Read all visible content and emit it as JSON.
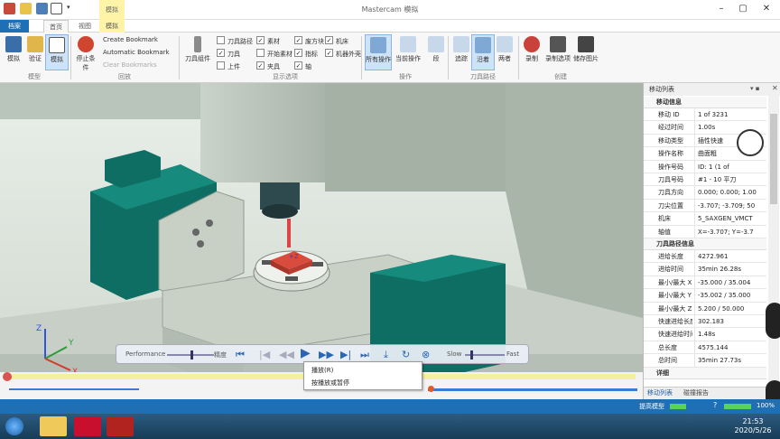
{
  "window": {
    "title": "Mastercam 模拟",
    "context_tab": "模拟"
  },
  "tabs": [
    "档案",
    "首页",
    "视图",
    "模拟"
  ],
  "ribbon": {
    "groups": {
      "model": "模型",
      "playback": "回放",
      "display": "显示选项",
      "ops": "操作",
      "toolpath": "刀具路径",
      "creation": "创建"
    },
    "buttons": {
      "sim": "模拟",
      "verify": "验证",
      "sim2": "模拟",
      "stop": "停止条件",
      "create_bookmark": "Create Bookmark",
      "auto_bookmark": "Automatic Bookmark",
      "clear_bookmarks": "Clear Bookmarks",
      "tool_group": "刀具组件",
      "all_ops": "所有操作",
      "current_op": "当前操作",
      "segment": "段",
      "trace": "追踪",
      "trail": "沿着",
      "both": "两者",
      "record": "录制",
      "record_export": "录制选项",
      "save_image": "储存图片"
    },
    "checkboxes": [
      {
        "label": "刀具路径",
        "checked": false
      },
      {
        "label": "刀具",
        "checked": true
      },
      {
        "label": "上件",
        "checked": false
      },
      {
        "label": "素材",
        "checked": true
      },
      {
        "label": "开始素材",
        "checked": false
      },
      {
        "label": "夹具",
        "checked": true
      },
      {
        "label": "废方块",
        "checked": true
      },
      {
        "label": "指标",
        "checked": true
      },
      {
        "label": "轴",
        "checked": true
      },
      {
        "label": "机床",
        "checked": true
      },
      {
        "label": "机器外壳",
        "checked": true
      }
    ]
  },
  "panel": {
    "title": "移动列表",
    "sections": {
      "move": "移动信息",
      "toolpath": "刀具路径信息",
      "detail": "详细"
    },
    "move_info": [
      {
        "k": "移动 ID",
        "v": "1 of 3231"
      },
      {
        "k": "经过时间",
        "v": "1.00s"
      },
      {
        "k": "移动类型",
        "v": "插性快速"
      },
      {
        "k": "操作名称",
        "v": "曲面粗"
      },
      {
        "k": "操作号码",
        "v": "ID: 1 (1 of"
      },
      {
        "k": "刀具号码",
        "v": "#1 - 10 平刀"
      },
      {
        "k": "刀具方向",
        "v": "0.000; 0.000; 1.00"
      },
      {
        "k": "刀尖位置",
        "v": "-3.707; -3.709; 50"
      },
      {
        "k": "机床",
        "v": "5_SAXGEN_VMCT"
      },
      {
        "k": "轴值",
        "v": "X=-3.707; Y=-3.7"
      }
    ],
    "toolpath_info": [
      {
        "k": "进给长度",
        "v": "4272.961"
      },
      {
        "k": "进给时间",
        "v": "35min 26.28s"
      },
      {
        "k": "最小/最大 X",
        "v": "-35.000 / 35.004"
      },
      {
        "k": "最小/最大 Y",
        "v": "-35.002 / 35.000"
      },
      {
        "k": "最小/最大 Z",
        "v": "5.200 / 50.000"
      },
      {
        "k": "快速进给长度",
        "v": "302.183"
      },
      {
        "k": "快速进给时间",
        "v": "1.48s"
      },
      {
        "k": "总长度",
        "v": "4575.144"
      },
      {
        "k": "总时间",
        "v": "35min 27.73s"
      }
    ],
    "tabs": {
      "move_list": "移动列表",
      "trace_report": "碰撞报告"
    }
  },
  "playbar": {
    "performance": "Performance",
    "precision": "精度",
    "slow": "Slow",
    "fast": "Fast"
  },
  "tooltip": {
    "title": "播放(R)",
    "desc": "按播放或暂停"
  },
  "status": {
    "label": "提高模型",
    "zoom": "100%"
  },
  "clock": {
    "time": "21:53",
    "date": "2020/5/26"
  },
  "colors": {
    "accent": "#1f6fb5",
    "machine_green": "#0f6e63",
    "part_red": "#d94b3c"
  }
}
